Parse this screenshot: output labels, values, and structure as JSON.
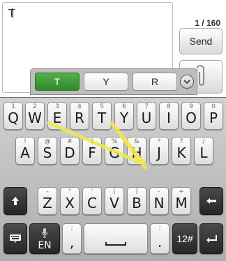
{
  "compose": {
    "message_text": "T",
    "char_counter": "1 / 160",
    "send_label": "Send",
    "attach_icon": "paperclip-icon"
  },
  "suggestions": {
    "items": [
      "T",
      "Y",
      "R"
    ],
    "active_index": 0,
    "more_icon": "chevron-down-icon"
  },
  "keyboard": {
    "row1": [
      {
        "main": "Q",
        "sup": "1"
      },
      {
        "main": "W",
        "sup": "2"
      },
      {
        "main": "E",
        "sup": "3"
      },
      {
        "main": "R",
        "sup": "4"
      },
      {
        "main": "T",
        "sup": "5"
      },
      {
        "main": "Y",
        "sup": "6"
      },
      {
        "main": "U",
        "sup": "7"
      },
      {
        "main": "I",
        "sup": "8"
      },
      {
        "main": "O",
        "sup": "9"
      },
      {
        "main": "P",
        "sup": "0"
      }
    ],
    "row2": [
      {
        "main": "A",
        "sup": "!"
      },
      {
        "main": "S",
        "sup": "@"
      },
      {
        "main": "D",
        "sup": "#"
      },
      {
        "main": "F",
        "sup": "$"
      },
      {
        "main": "G",
        "sup": "%"
      },
      {
        "main": "H",
        "sup": "&"
      },
      {
        "main": "J",
        "sup": "*"
      },
      {
        "main": "K",
        "sup": "?"
      },
      {
        "main": "L",
        "sup": "/"
      }
    ],
    "row3": [
      {
        "main": "Z",
        "sup": "-"
      },
      {
        "main": "X",
        "sup": "\""
      },
      {
        "main": "C",
        "sup": "'"
      },
      {
        "main": "V",
        "sup": "("
      },
      {
        "main": "B",
        "sup": ")"
      },
      {
        "main": "N",
        "sup": "-"
      },
      {
        "main": "M",
        "sup": "+"
      }
    ],
    "shift_icon": "shift-arrow-icon",
    "backspace_icon": "backspace-icon",
    "keyboard_icon": "keyboard-icon",
    "mic_icon": "microphone-icon",
    "lang_label": "EN",
    "semicolon_sup": ";",
    "comma_main": ",",
    "space_icon": "space-bar-icon",
    "colon_sup": ":",
    "period_main": ".",
    "symbols_label": "12#",
    "enter_icon": "enter-icon",
    "gesture_trace_color": "#f0e84a"
  }
}
